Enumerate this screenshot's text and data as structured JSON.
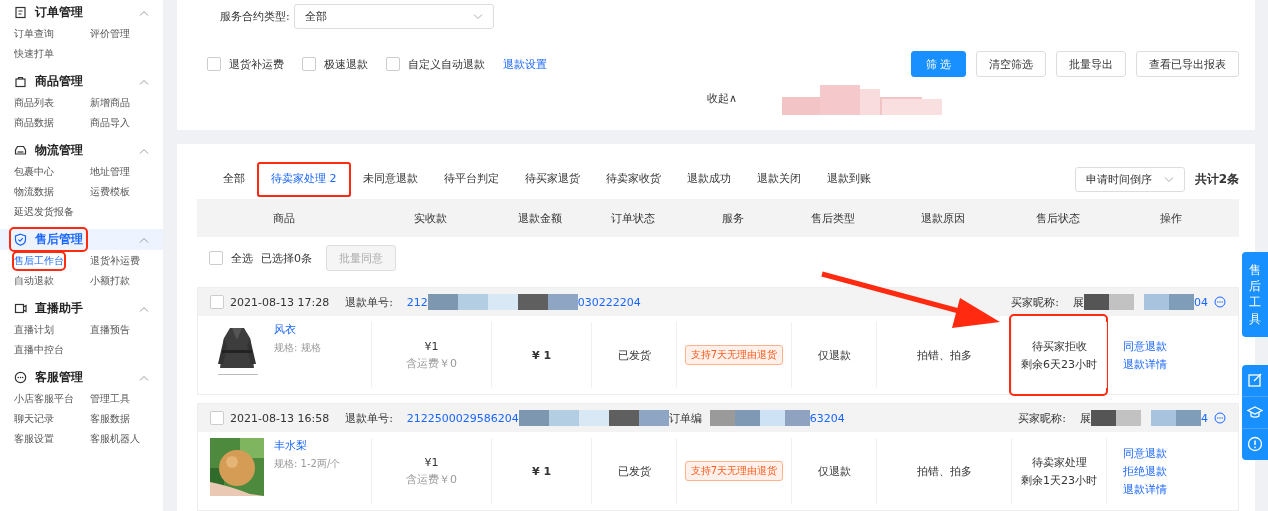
{
  "sidebar": {
    "sections": [
      {
        "title": "订单管理",
        "expanded": true,
        "selected": false,
        "highlighted": false,
        "items": [
          {
            "label": "订单查询",
            "selected": false,
            "highlighted": false
          },
          {
            "label": "评价管理",
            "selected": false,
            "highlighted": false
          },
          {
            "label": "快速打单",
            "selected": false,
            "highlighted": false
          }
        ]
      },
      {
        "title": "商品管理",
        "expanded": true,
        "selected": false,
        "highlighted": false,
        "items": [
          {
            "label": "商品列表",
            "selected": false,
            "highlighted": false
          },
          {
            "label": "新增商品",
            "selected": false,
            "highlighted": false
          },
          {
            "label": "商品数据",
            "selected": false,
            "highlighted": false
          },
          {
            "label": "商品导入",
            "selected": false,
            "highlighted": false
          }
        ]
      },
      {
        "title": "物流管理",
        "expanded": true,
        "selected": false,
        "highlighted": false,
        "items": [
          {
            "label": "包裹中心",
            "selected": false,
            "highlighted": false
          },
          {
            "label": "地址管理",
            "selected": false,
            "highlighted": false
          },
          {
            "label": "物流数据",
            "selected": false,
            "highlighted": false
          },
          {
            "label": "运费模板",
            "selected": false,
            "highlighted": false
          },
          {
            "label": "延迟发货报备",
            "selected": false,
            "highlighted": false
          }
        ]
      },
      {
        "title": "售后管理",
        "expanded": true,
        "selected": true,
        "highlighted": true,
        "items": [
          {
            "label": "售后工作台",
            "selected": true,
            "highlighted": true
          },
          {
            "label": "退货补运费",
            "selected": false,
            "highlighted": false
          },
          {
            "label": "自动退款",
            "selected": false,
            "highlighted": false
          },
          {
            "label": "小额打款",
            "selected": false,
            "highlighted": false
          }
        ]
      },
      {
        "title": "直播助手",
        "expanded": true,
        "selected": false,
        "highlighted": false,
        "items": [
          {
            "label": "直播计划",
            "selected": false,
            "highlighted": false
          },
          {
            "label": "直播预告",
            "selected": false,
            "highlighted": false
          },
          {
            "label": "直播中控台",
            "selected": false,
            "highlighted": false
          }
        ]
      },
      {
        "title": "客服管理",
        "expanded": true,
        "selected": false,
        "highlighted": false,
        "items": [
          {
            "label": "小店客服平台",
            "selected": false,
            "highlighted": false
          },
          {
            "label": "管理工具",
            "selected": false,
            "highlighted": false
          },
          {
            "label": "聊天记录",
            "selected": false,
            "highlighted": false
          },
          {
            "label": "客服数据",
            "selected": false,
            "highlighted": false
          },
          {
            "label": "客服设置",
            "selected": false,
            "highlighted": false
          },
          {
            "label": "客服机器人",
            "selected": false,
            "highlighted": false
          }
        ]
      }
    ]
  },
  "filter": {
    "service_type": {
      "label": "服务合约类型:",
      "value": "全部"
    },
    "checkboxes": [
      {
        "label": "退货补运费",
        "checked": false
      },
      {
        "label": "极速退款",
        "checked": false
      },
      {
        "label": "自定义自动退款",
        "checked": false
      }
    ],
    "settings_link": "退款设置",
    "buttons": [
      {
        "label": "筛 选",
        "kind": "primary"
      },
      {
        "label": "清空筛选",
        "kind": "default"
      },
      {
        "label": "批量导出",
        "kind": "default"
      },
      {
        "label": "查看已导出报表",
        "kind": "default"
      }
    ],
    "collapse": "收起∧"
  },
  "tabs": [
    {
      "label": "全部",
      "selected": false,
      "highlighted": false
    },
    {
      "label": "待卖家处理 2",
      "selected": true,
      "highlighted": true
    },
    {
      "label": "未同意退款",
      "selected": false,
      "highlighted": false
    },
    {
      "label": "待平台判定",
      "selected": false,
      "highlighted": false
    },
    {
      "label": "待买家退货",
      "selected": false,
      "highlighted": false
    },
    {
      "label": "待卖家收货",
      "selected": false,
      "highlighted": false
    },
    {
      "label": "退款成功",
      "selected": false,
      "highlighted": false
    },
    {
      "label": "退款关闭",
      "selected": false,
      "highlighted": false
    },
    {
      "label": "退款到账",
      "selected": false,
      "highlighted": false
    }
  ],
  "sort": "申请时间倒序",
  "total": "共计2条",
  "table": {
    "columns": [
      "商品",
      "实收款",
      "退款金额",
      "订单状态",
      "服务",
      "售后类型",
      "退款原因",
      "售后状态",
      "操作"
    ]
  },
  "select_all": {
    "label": "全选",
    "checked": false,
    "count": "已选择0条",
    "batch_button": {
      "label": "批量同意",
      "disabled": true
    }
  },
  "orders": [
    {
      "checked": false,
      "time": "2021-08-13 17:28",
      "refund_label": "退款单号:",
      "refund_no_start": "212",
      "refund_no_end": "030222204",
      "buyer_label": "买家昵称:",
      "buyer_start": "展",
      "buyer_end": "04",
      "product": {
        "name": "风衣",
        "spec": "规格: 规格"
      },
      "paid": "¥1",
      "shipping": "含运费￥0",
      "refund": "¥ 1",
      "order_status": "已发货",
      "service_tag": "支持7天无理由退货",
      "type": "仅退款",
      "reason": "拍错、拍多",
      "status": [
        "待买家拒收",
        "剩余6天23小时"
      ],
      "status_highlighted": true,
      "arrow_to_status": true,
      "actions": [
        "同意退款",
        "退款详情"
      ]
    },
    {
      "checked": false,
      "time": "2021-08-13 16:58",
      "refund_label": "退款单号:",
      "refund_no_start": "2122500029586204",
      "order_label": "订单编",
      "order_no_end": "63204",
      "buyer_label": "买家昵称:",
      "buyer_start": "展",
      "buyer_end": "4",
      "product": {
        "name": "丰水梨",
        "spec": "规格: 1-2两/个"
      },
      "paid": "¥1",
      "shipping": "含运费￥0",
      "refund": "¥ 1",
      "order_status": "已发货",
      "service_tag": "支持7天无理由退货",
      "type": "仅退款",
      "reason": "拍错、拍多",
      "status": [
        "待卖家处理",
        "剩余1天23小时"
      ],
      "status_highlighted": false,
      "arrow_to_status": false,
      "actions": [
        "同意退款",
        "拒绝退款",
        "退款详情"
      ]
    }
  ],
  "side_tools": {
    "title": "售后工具"
  }
}
